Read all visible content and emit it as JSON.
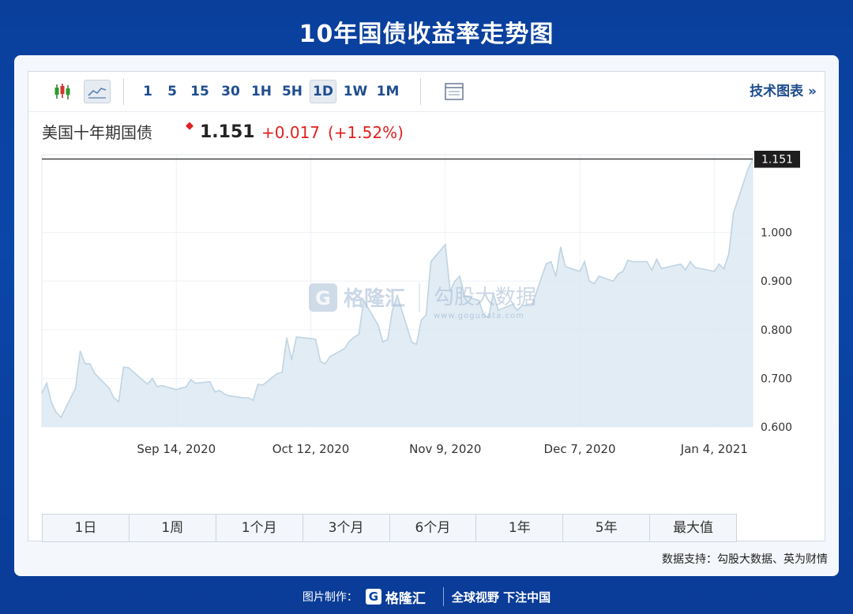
{
  "page_title": "10年国债收益率走势图",
  "toolbar": {
    "intervals": [
      "1",
      "5",
      "15",
      "30",
      "1H",
      "5H",
      "1D",
      "1W",
      "1M"
    ],
    "active_interval": "1D",
    "tech_link": "技术图表 »"
  },
  "quote": {
    "name": "美国十年期国债",
    "price": "1.151",
    "change": "+0.017",
    "change_pct": "(+1.52%)"
  },
  "watermark": {
    "brand": "格隆汇",
    "partner": "勾股大数据",
    "url": "www.gogudata.com"
  },
  "ranges": [
    "1日",
    "1周",
    "1个月",
    "3个月",
    "6个月",
    "1年",
    "5年",
    "最大值"
  ],
  "source": "数据支持：勾股大数据、英为财情",
  "footer": {
    "label": "图片制作：",
    "brand": "格隆汇",
    "slogan": "全球视野 下注中国"
  },
  "colors": {
    "line": "#c0d4e3",
    "fill": "#dce9f2",
    "last_price_line": "#444444",
    "up": "#e02020",
    "accent": "#1f4d8f"
  },
  "chart_data": {
    "type": "area",
    "title": "",
    "xlabel": "",
    "ylabel": "",
    "ylim": [
      0.6,
      1.16
    ],
    "y_ticks": [
      0.6,
      0.7,
      0.8,
      0.9,
      1.0
    ],
    "y_tick_labels": [
      "0.600",
      "0.700",
      "0.800",
      "0.900",
      "1.000"
    ],
    "x_ticks": [
      "2020-09-14",
      "2020-10-12",
      "2020-11-09",
      "2020-12-07",
      "2021-01-04"
    ],
    "x_tick_labels": [
      "Sep 14, 2020",
      "Oct 12, 2020",
      "Nov 9, 2020",
      "Dec 7, 2020",
      "Jan 4, 2021"
    ],
    "last_value": 1.151,
    "last_value_label": "1.151",
    "grid": true,
    "series": [
      {
        "x": [
          "2020-08-17",
          "2020-08-18",
          "2020-08-19",
          "2020-08-20",
          "2020-08-21",
          "2020-08-24",
          "2020-08-25",
          "2020-08-26",
          "2020-08-27",
          "2020-08-28",
          "2020-08-31",
          "2020-09-01",
          "2020-09-02",
          "2020-09-03",
          "2020-09-04",
          "2020-09-08",
          "2020-09-09",
          "2020-09-10",
          "2020-09-11",
          "2020-09-14",
          "2020-09-15",
          "2020-09-16",
          "2020-09-17",
          "2020-09-18",
          "2020-09-21",
          "2020-09-22",
          "2020-09-23",
          "2020-09-24",
          "2020-09-25",
          "2020-09-28",
          "2020-09-29",
          "2020-09-30",
          "2020-10-01",
          "2020-10-02",
          "2020-10-05",
          "2020-10-06",
          "2020-10-07",
          "2020-10-08",
          "2020-10-09",
          "2020-10-12",
          "2020-10-13",
          "2020-10-14",
          "2020-10-15",
          "2020-10-16",
          "2020-10-19",
          "2020-10-20",
          "2020-10-21",
          "2020-10-22",
          "2020-10-23",
          "2020-10-26",
          "2020-10-27",
          "2020-10-28",
          "2020-10-29",
          "2020-10-30",
          "2020-11-02",
          "2020-11-03",
          "2020-11-04",
          "2020-11-05",
          "2020-11-06",
          "2020-11-09",
          "2020-11-10",
          "2020-11-11",
          "2020-11-12",
          "2020-11-13",
          "2020-11-16",
          "2020-11-17",
          "2020-11-18",
          "2020-11-19",
          "2020-11-20",
          "2020-11-23",
          "2020-11-24",
          "2020-11-25",
          "2020-11-27",
          "2020-11-30",
          "2020-12-01",
          "2020-12-02",
          "2020-12-03",
          "2020-12-04",
          "2020-12-07",
          "2020-12-08",
          "2020-12-09",
          "2020-12-10",
          "2020-12-11",
          "2020-12-14",
          "2020-12-15",
          "2020-12-16",
          "2020-12-17",
          "2020-12-18",
          "2020-12-21",
          "2020-12-22",
          "2020-12-23",
          "2020-12-24",
          "2020-12-28",
          "2020-12-29",
          "2020-12-30",
          "2020-12-31",
          "2021-01-04",
          "2021-01-05",
          "2021-01-06",
          "2021-01-07",
          "2021-01-08",
          "2021-01-11",
          "2021-01-12"
        ],
        "y": [
          0.67,
          0.69,
          0.65,
          0.63,
          0.62,
          0.68,
          0.756,
          0.73,
          0.73,
          0.71,
          0.68,
          0.66,
          0.652,
          0.723,
          0.722,
          0.688,
          0.7,
          0.683,
          0.685,
          0.677,
          0.68,
          0.682,
          0.697,
          0.69,
          0.693,
          0.672,
          0.675,
          0.668,
          0.664,
          0.66,
          0.66,
          0.655,
          0.688,
          0.686,
          0.71,
          0.712,
          0.783,
          0.738,
          0.785,
          0.782,
          0.78,
          0.735,
          0.73,
          0.745,
          0.761,
          0.776,
          0.785,
          0.79,
          0.86,
          0.81,
          0.775,
          0.78,
          0.84,
          0.87,
          0.775,
          0.77,
          0.82,
          0.83,
          0.94,
          0.975,
          0.88,
          0.9,
          0.91,
          0.87,
          0.86,
          0.83,
          0.825,
          0.875,
          0.84,
          0.852,
          0.84,
          0.85,
          0.85,
          0.935,
          0.94,
          0.91,
          0.97,
          0.93,
          0.92,
          0.94,
          0.9,
          0.895,
          0.91,
          0.9,
          0.915,
          0.92,
          0.943,
          0.94,
          0.94,
          0.922,
          0.945,
          0.926,
          0.935,
          0.923,
          0.94,
          0.928,
          0.92,
          0.935,
          0.925,
          0.955,
          1.04,
          1.13,
          1.151
        ]
      }
    ]
  }
}
